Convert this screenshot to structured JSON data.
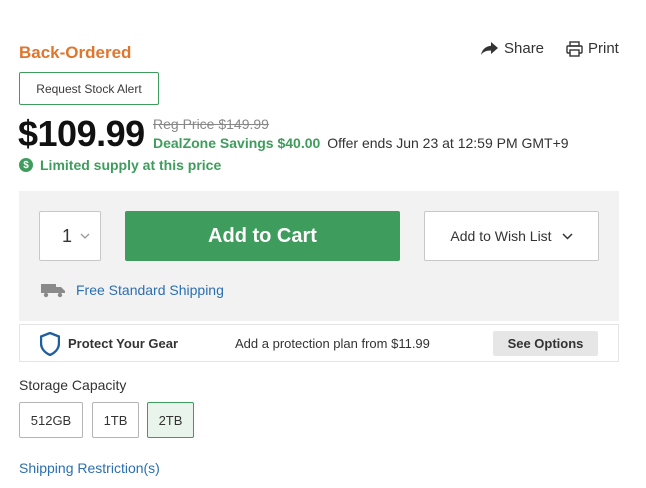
{
  "availability": {
    "status": "Back-Ordered"
  },
  "actions": {
    "share_label": "Share",
    "print_label": "Print"
  },
  "stock_alert": {
    "label": "Request Stock Alert"
  },
  "pricing": {
    "price": "$109.99",
    "reg_price": "Reg Price $149.99",
    "savings": "DealZone Savings $40.00",
    "offer": "Offer ends Jun 23 at 12:59 PM GMT+9",
    "limited": "Limited supply at this price"
  },
  "cart": {
    "quantity": "1",
    "add_to_cart_label": "Add to Cart",
    "wish_list_label": "Add to Wish List",
    "shipping_label": "Free Standard Shipping"
  },
  "protection": {
    "title": "Protect Your Gear",
    "text": "Add a protection plan from $11.99",
    "button_label": "See Options"
  },
  "storage": {
    "label": "Storage Capacity",
    "options": [
      "512GB",
      "1TB",
      "2TB"
    ],
    "selected": "2TB"
  },
  "links": {
    "shipping_restrictions": "Shipping Restriction(s)"
  },
  "colors": {
    "accent_green": "#3e9c5c",
    "status_orange": "#e0762d",
    "link_blue": "#2b6fb1"
  },
  "icons": [
    "share-icon",
    "print-icon",
    "dollar-icon",
    "chevron-down-icon",
    "truck-icon",
    "shield-icon"
  ]
}
